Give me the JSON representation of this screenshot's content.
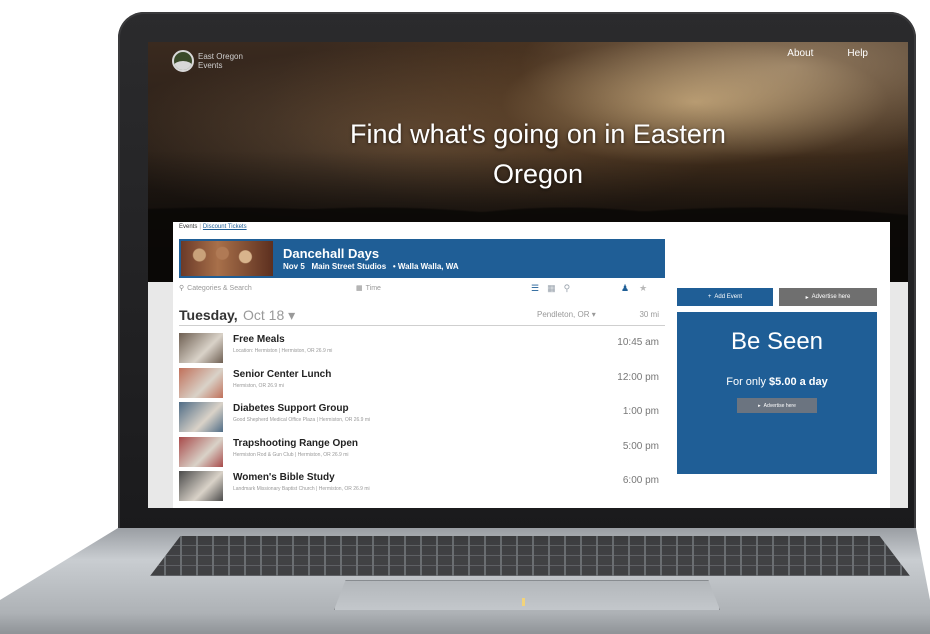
{
  "site": {
    "logo_text_line1": "East Oregon",
    "logo_text_line2": "Events"
  },
  "nav": {
    "about": "About",
    "help": "Help"
  },
  "hero": {
    "title_line1": "Find what's going on in Eastern",
    "title_line2": "Oregon"
  },
  "tabs": {
    "events": "Events",
    "discount": "Discount Tickets"
  },
  "featured": {
    "title": "Dancehall Days",
    "date": "Nov 5",
    "venue": "Main Street Studios",
    "location": "• Walla Walla, WA"
  },
  "filters": {
    "categories_placeholder": "Categories & Search",
    "time_placeholder": "Time"
  },
  "date_header": {
    "day": "Tuesday,",
    "date": "Oct 18 ▾",
    "location": "Pendleton, OR ▾",
    "distance": "30 mi"
  },
  "events": [
    {
      "title": "Free Meals",
      "meta": "Location: Hermiston | Hermiston, OR   26.9 mi",
      "time": "10:45 am",
      "thumb_color": "#6e5f52"
    },
    {
      "title": "Senior Center Lunch",
      "meta": "Hermiston, OR   26.9 mi",
      "time": "12:00 pm",
      "thumb_color": "#c0705a"
    },
    {
      "title": "Diabetes Support Group",
      "meta": "Good Shepherd Medical Office Plaza | Hermiston, OR   26.9 mi",
      "time": "1:00 pm",
      "thumb_color": "#4f6c86"
    },
    {
      "title": "Trapshooting Range Open",
      "meta": "Hermiston Rod & Gun Club | Hermiston, OR   26.9 mi",
      "time": "5:00 pm",
      "thumb_color": "#a84a4a"
    },
    {
      "title": "Women's Bible Study",
      "meta": "Landmark Missionary Baptist Church | Hermiston, OR   26.9 mi",
      "time": "6:00 pm",
      "thumb_color": "#4a4a4a"
    }
  ],
  "sidebar": {
    "add_event": "Add Event",
    "advertise_here": "Advertise here",
    "promo_title": "Be Seen",
    "promo_sub_prefix": "For only ",
    "promo_price": "$5.00 a day",
    "promo_button": "Advertise here"
  },
  "colors": {
    "accent": "#1f5e96",
    "gray_button": "#6f6f6f"
  }
}
